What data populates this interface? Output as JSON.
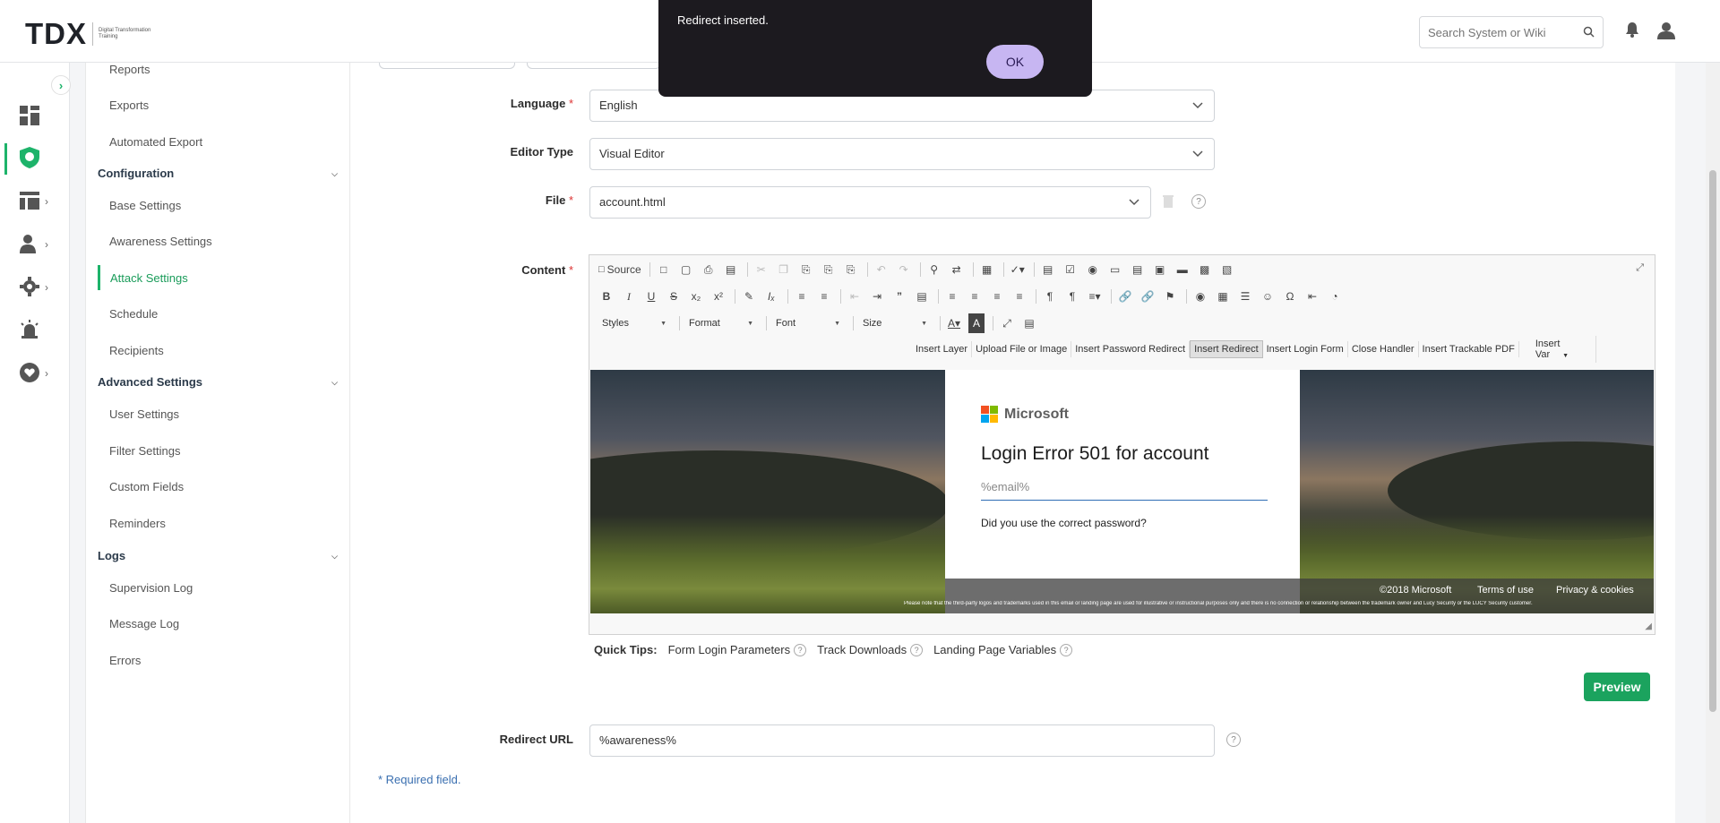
{
  "app": {
    "logo_main": "TDX",
    "logo_sub": "Digital Transformation Training"
  },
  "header": {
    "search_placeholder": "Search System or Wiki"
  },
  "sidebar": {
    "items": [
      {
        "label": "Reports"
      },
      {
        "label": "Exports"
      },
      {
        "label": "Automated Export"
      }
    ],
    "groups": [
      {
        "label": "Configuration",
        "items": [
          "Base Settings",
          "Awareness Settings",
          "Attack Settings",
          "Schedule",
          "Recipients"
        ]
      },
      {
        "label": "Advanced Settings",
        "items": [
          "User Settings",
          "Filter Settings",
          "Custom Fields",
          "Reminders"
        ]
      },
      {
        "label": "Logs",
        "items": [
          "Supervision Log",
          "Message Log",
          "Errors"
        ]
      }
    ],
    "active_item": "Attack Settings"
  },
  "form": {
    "language": {
      "label": "Language",
      "value": "English"
    },
    "editor_type": {
      "label": "Editor Type",
      "value": "Visual Editor"
    },
    "file": {
      "label": "File",
      "value": "account.html"
    },
    "content": {
      "label": "Content"
    },
    "redirect_url": {
      "label": "Redirect URL",
      "value": "%awareness%"
    },
    "required_note": "* Required field.",
    "required_mark": "*"
  },
  "editor": {
    "source_label": "Source",
    "combos": [
      "Styles",
      "Format",
      "Font",
      "Size"
    ],
    "insert_buttons": [
      "Insert Layer",
      "Upload File or Image",
      "Insert Password Redirect",
      "Insert Redirect",
      "Insert Login Form",
      "Close Handler",
      "Insert Trackable PDF"
    ],
    "pressed_button": "Insert Redirect",
    "insert_var_label": "Insert Var"
  },
  "preview_page": {
    "brand": "Microsoft",
    "title": "Login Error 501 for account",
    "input_value": "%email%",
    "question": "Did you use the correct password?",
    "copyright": "©2018 Microsoft",
    "terms": "Terms of use",
    "privacy": "Privacy & cookies",
    "disclaimer": "Please note that the third-party logos and trademarks used in this email or landing page are used for illustrative or instructional purposes only and there is no connection or relationship between the trademark owner and Lucy Security or the LUCY Security customer."
  },
  "quick_tips": {
    "label": "Quick Tips:",
    "links": [
      "Form Login Parameters",
      "Track Downloads",
      "Landing Page Variables"
    ]
  },
  "buttons": {
    "preview": "Preview"
  },
  "toast": {
    "message": "Redirect inserted.",
    "ok_label": "OK"
  },
  "colors": {
    "accent": "#1db36a",
    "button_green": "#1ba35e",
    "toast_bg": "#1c1a1f",
    "toast_ok": "#c7b6f2"
  }
}
